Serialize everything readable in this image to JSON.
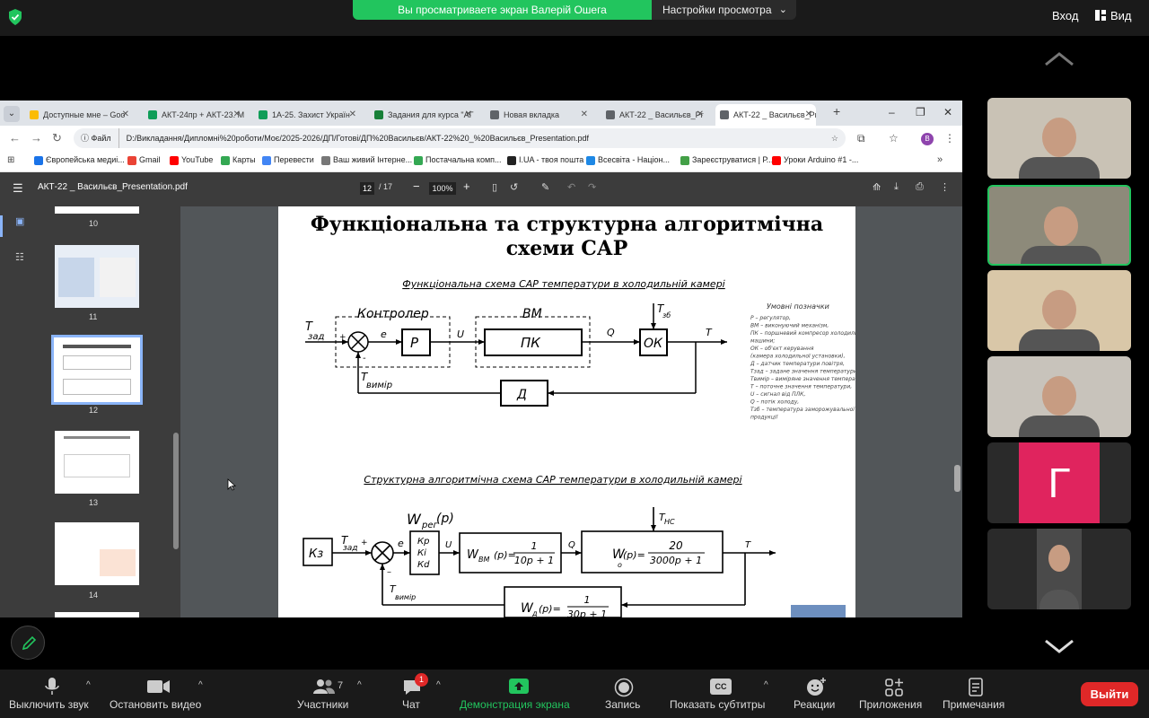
{
  "zoom_top": {
    "share_banner": "Вы просматриваете экран Валерій Ошега",
    "view_settings": "Настройки просмотра",
    "login": "Вход",
    "view": "Вид"
  },
  "browser": {
    "tabs": [
      {
        "label": "Доступные мне – Goo",
        "color": "#fbbc04"
      },
      {
        "label": "АКТ-24пр + АКТ-23. М",
        "color": "#0f9d58"
      },
      {
        "label": "1А-25. Захист Україн",
        "color": "#0f9d58"
      },
      {
        "label": "Задания для курса \"АГ",
        "color": "#188038"
      },
      {
        "label": "Новая вкладка",
        "color": "#5f6368"
      },
      {
        "label": "АКТ-22 _ Васильєв_Pr",
        "color": "#5f6368"
      },
      {
        "label": "АКТ-22 _ Васильєв_Pr",
        "color": "#5f6368"
      }
    ],
    "file_chip": "Файл",
    "url": "D:/Викладання/Дипломні%20роботи/Моє/2025-2026/ДП/Готові/ДП%20Васильєв/АКТ-22%20_%20Васильєв_Presentation.pdf",
    "profile_letter": "В",
    "bookmarks": [
      {
        "label": "Європейська медиі...",
        "color": "#1a73e8"
      },
      {
        "label": "Gmail",
        "color": "#ea4335"
      },
      {
        "label": "YouTube",
        "color": "#ff0000"
      },
      {
        "label": "Карты",
        "color": "#34a853"
      },
      {
        "label": "Перевести",
        "color": "#4285f4"
      },
      {
        "label": "Ваш живий Інтерне...",
        "color": "#777777"
      },
      {
        "label": "Постачальна комп...",
        "color": "#34a853"
      },
      {
        "label": "I.UA - твоя пошта",
        "color": "#222222"
      },
      {
        "label": "Всесвіта - Націон...",
        "color": "#1e88e5"
      },
      {
        "label": "Зареєструватися | Р...",
        "color": "#43a047"
      },
      {
        "label": "Уроки Arduino #1 -...",
        "color": "#ff0000"
      }
    ]
  },
  "pdf": {
    "title": "АКТ-22 _ Васильєв_Presentation.pdf",
    "page": "12",
    "page_total": "/ 17",
    "zoom": "100%",
    "thumbs": [
      "10",
      "11",
      "12",
      "13",
      "14"
    ],
    "slide": {
      "title": "Функціональна та структурна алгоритмічна схеми САР",
      "func_caption": "Функціональна схема САР температури в холодильній камері",
      "struct_caption": "Структурна алгоритмічна схема САР температури в холодильній камері",
      "func": {
        "t_zad": "Т",
        "t_zad_sub": "зад",
        "plus": "+",
        "minus": "-",
        "e": "е",
        "controller": "Контролер",
        "p": "Р",
        "u": "U",
        "bm": "ВМ",
        "pk": "ПК",
        "q": "Q",
        "ok": "ОК",
        "t": "Т",
        "t_zb": "Т",
        "t_zb_sub": "зб",
        "d": "Д",
        "t_vymir": "Т",
        "t_vymir_sub": "вимір"
      },
      "legend": {
        "title": "Умовні позначки",
        "lines": [
          "Р – регулятор,",
          "ВМ – виконуючий механізм,",
          "ПК – поршневий компресор холодильної",
          "машини;",
          "ОК – об'єкт керування",
          "(камера холодильної установки),",
          "Д – датчик температури повітря,",
          "Тзад – задане значення температури,",
          "Твимір – виміряне значення температури,",
          "Т – поточне значення температури,",
          "U – сигнал від ПЛК,",
          "Q – потік холоду,",
          "Тзб – температура заморожувальної",
          "продукції"
        ]
      },
      "struct": {
        "kz": "Кз",
        "t_zad": "Т",
        "t_zad_sub": "зад",
        "plus": "+",
        "minus": "–",
        "e": "e",
        "w_reg": "W",
        "w_reg_sub": "рег",
        "w_reg_arg": "(р)",
        "kp": "Кр",
        "ki": "Кі",
        "kd": "Кd",
        "u": "U",
        "w_vm": "W",
        "w_vm_sub": "ВМ",
        "w_vm_num": "1",
        "w_vm_den": "10р + 1",
        "w_vm_arg": "(р)=",
        "q": "Q",
        "t_ns": "Т",
        "t_ns_sub": "НС",
        "w_o": "W",
        "w_o_sub": "о",
        "w_o_arg": "(р)=",
        "w_o_num": "20",
        "w_o_den": "3000р + 1",
        "t": "Т",
        "t_vymir": "Т",
        "t_vymir_sub": "вимір",
        "w_d": "W",
        "w_d_sub": "д",
        "w_d_arg": "(р)=",
        "w_d_num": "1",
        "w_d_den": "30р + 1"
      }
    }
  },
  "participants": [
    {
      "name": "participant-1",
      "bg": "#c9c2b5"
    },
    {
      "name": "participant-2",
      "bg": "#8d8a7a"
    },
    {
      "name": "participant-3",
      "bg": "#d9c7a8"
    },
    {
      "name": "participant-4",
      "bg": "#c8c3bb"
    },
    {
      "name": "participant-5",
      "initial": "Г",
      "bg": "#e0245e"
    },
    {
      "name": "participant-6",
      "bg": "#4a4a4a"
    }
  ],
  "bottom": {
    "mute": "Выключить звук",
    "video": "Остановить видео",
    "participants": "Участники",
    "participants_count": "7",
    "chat": "Чат",
    "chat_badge": "1",
    "share": "Демонстрация экрана",
    "record": "Запись",
    "subtitles": "Показать субтитры",
    "reactions": "Реакции",
    "apps": "Приложения",
    "notes": "Примечания",
    "exit": "Выйти",
    "cc": "CC"
  }
}
